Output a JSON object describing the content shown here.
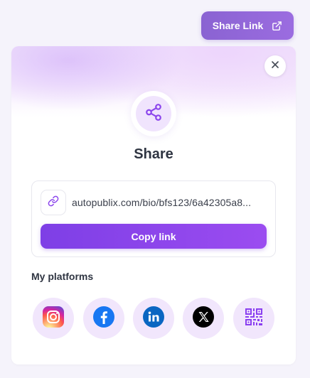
{
  "header": {
    "share_link_label": "Share Link"
  },
  "card": {
    "title": "Share",
    "link": {
      "url": "autopublix.com/bio/bfs123/6a42305a8..."
    },
    "copy_label": "Copy link",
    "platforms_label": "My platforms",
    "platforms": [
      {
        "name": "Instagram",
        "icon": "instagram-icon",
        "color": "#e1306c"
      },
      {
        "name": "Facebook",
        "icon": "facebook-icon",
        "color": "#1877f2"
      },
      {
        "name": "LinkedIn",
        "icon": "linkedin-icon",
        "color": "#0a66c2"
      },
      {
        "name": "X",
        "icon": "x-icon",
        "color": "#000000"
      },
      {
        "name": "QR code",
        "icon": "qr-code-icon",
        "color": "#8a3ff0"
      }
    ]
  },
  "colors": {
    "accent": "#8b45ec",
    "accent_light": "#f1e6fc",
    "text_dark": "#2f3542"
  }
}
